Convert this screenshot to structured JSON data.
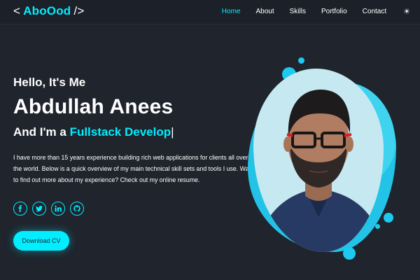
{
  "header": {
    "logo_open": "<",
    "logo_name": "AboOod",
    "logo_close": "/>",
    "nav": [
      {
        "label": "Home",
        "active": true
      },
      {
        "label": "About",
        "active": false
      },
      {
        "label": "Skills",
        "active": false
      },
      {
        "label": "Portfolio",
        "active": false
      },
      {
        "label": "Contact",
        "active": false
      }
    ],
    "theme_icon": "☀"
  },
  "hero": {
    "greeting": "Hello, It's Me",
    "name": "Abdullah Anees",
    "role_prefix": "And I'm a",
    "role_typed": "Fullstack Develop",
    "caret": "|",
    "description": "I have more than 15 years experience building rich web applications for clients all over the world. Below is a quick overview of my main technical skill sets and tools I use. Want to find out more about my experience? Check out my online resume.",
    "socials": [
      "facebook-icon",
      "twitter-icon",
      "linkedin-icon",
      "github-icon"
    ],
    "download_label": "Download CV"
  },
  "colors": {
    "accent": "#00eeff",
    "background": "#1f242d",
    "blob": "#22c3e6"
  }
}
